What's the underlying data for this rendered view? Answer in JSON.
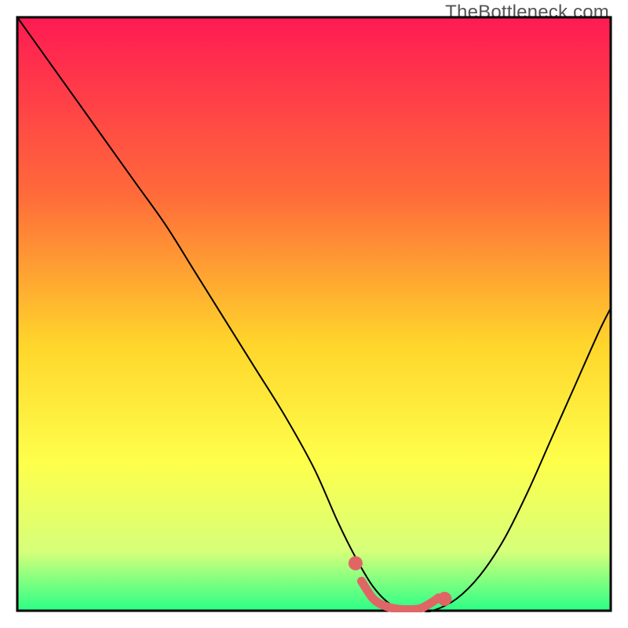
{
  "watermark": "TheBottleneck.com",
  "colors": {
    "gradient_top": "#ff1a53",
    "gradient_mid1": "#ff6b3a",
    "gradient_mid2": "#ffd52b",
    "gradient_mid3": "#feff4b",
    "gradient_mid4": "#d6ff7a",
    "gradient_bottom": "#2aff86",
    "axis": "#000000",
    "curve": "#000000",
    "marker": "#e06666"
  },
  "chart_data": {
    "type": "line",
    "title": "",
    "xlabel": "",
    "ylabel": "",
    "xlim": [
      0,
      100
    ],
    "ylim": [
      0,
      100
    ],
    "grid": false,
    "legend": false,
    "series": [
      {
        "name": "bottleneck-curve",
        "x": [
          0,
          5,
          10,
          15,
          20,
          25,
          30,
          35,
          40,
          45,
          50,
          54,
          57,
          60,
          63,
          66,
          68,
          70,
          74,
          78,
          82,
          86,
          90,
          94,
          98,
          100
        ],
        "y": [
          100,
          93,
          86,
          79,
          72,
          65,
          57,
          49,
          41,
          33,
          24,
          15,
          9,
          4,
          1,
          0,
          0,
          0,
          2,
          6,
          12,
          20,
          29,
          38,
          47,
          51
        ]
      }
    ],
    "markers": [
      {
        "name": "trough-start",
        "x": 57,
        "y": 8
      },
      {
        "name": "trough-end",
        "x": 72,
        "y": 2
      }
    ],
    "trough_segment": {
      "x": [
        58,
        60,
        62,
        64,
        66,
        68,
        70,
        71
      ],
      "y": [
        5,
        2,
        0.8,
        0.3,
        0.2,
        0.4,
        1.5,
        2.2
      ]
    }
  }
}
